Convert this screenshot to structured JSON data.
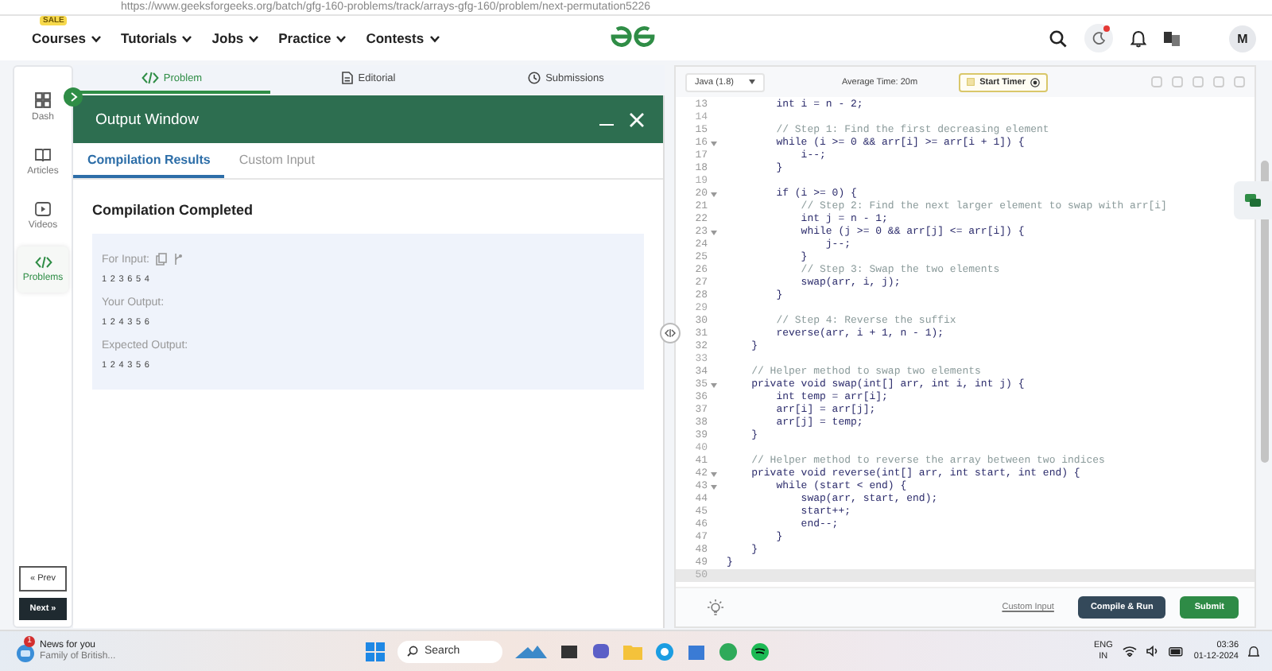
{
  "browser": {
    "url": "https://www.geeksforgeeks.org/batch/gfg-160-problems/track/arrays-gfg-160/problem/next-permutation5226"
  },
  "nav": {
    "badge": "SALE",
    "menus": [
      "Courses",
      "Tutorials",
      "Jobs",
      "Practice",
      "Contests"
    ],
    "streak_alert": true,
    "avatar": "M"
  },
  "sidebar": {
    "items": [
      {
        "label": "Dash",
        "selected": false
      },
      {
        "label": "Articles",
        "selected": false
      },
      {
        "label": "Videos",
        "selected": false
      },
      {
        "label": "Problems",
        "selected": true
      }
    ],
    "prev": "« Prev",
    "next": "Next »"
  },
  "problem_tabs": [
    {
      "label": "Problem",
      "selected": true
    },
    {
      "label": "Editorial",
      "selected": false
    },
    {
      "label": "Submissions",
      "selected": false
    }
  ],
  "output_window": {
    "title": "Output Window",
    "tabs": [
      {
        "label": "Compilation Results",
        "selected": true
      },
      {
        "label": "Custom Input",
        "selected": false
      }
    ],
    "status": "Compilation Completed",
    "results": [
      {
        "label": "For Input:",
        "value": "1 2 3 6 5 4",
        "tools": true
      },
      {
        "label": "Your Output:",
        "value": "1 2 4 3 5 6",
        "tools": false
      },
      {
        "label": "Expected Output:",
        "value": "1 2 4 3 5 6",
        "tools": false
      }
    ]
  },
  "editor": {
    "language": "Java (1.8)",
    "average_time": "Average Time: 20m",
    "timer": "Start Timer",
    "lines": [
      {
        "no": "13",
        "text": "        int i = n - 2;",
        "kind": "code",
        "fold": false,
        "current": false
      },
      {
        "no": "14",
        "kind": "code",
        "fold": false,
        "current": false
      },
      {
        "no": "15",
        "text": "        // Step 1: Find the first decreasing element",
        "kind": "comment",
        "fold": false,
        "current": false
      },
      {
        "no": "16",
        "text": "        while (i >= 0 && arr[i] >= arr[i + 1]) {",
        "kind": "code",
        "fold": true,
        "current": false
      },
      {
        "no": "17",
        "text": "            i--;",
        "kind": "code",
        "fold": false,
        "current": false
      },
      {
        "no": "18",
        "text": "        }",
        "kind": "code",
        "fold": false,
        "current": false
      },
      {
        "no": "19",
        "kind": "code",
        "fold": false,
        "current": false
      },
      {
        "no": "20",
        "text": "        if (i >= 0) {",
        "kind": "code",
        "fold": true,
        "current": false
      },
      {
        "no": "21",
        "text": "            // Step 2: Find the next larger element to swap with arr[i]",
        "kind": "comment",
        "fold": false,
        "current": false
      },
      {
        "no": "22",
        "text": "            int j = n - 1;",
        "kind": "code",
        "fold": false,
        "current": false
      },
      {
        "no": "23",
        "text": "            while (j >= 0 && arr[j] <= arr[i]) {",
        "kind": "code",
        "fold": true,
        "current": false
      },
      {
        "no": "24",
        "text": "                j--;",
        "kind": "code",
        "fold": false,
        "current": false
      },
      {
        "no": "25",
        "text": "            }",
        "kind": "code",
        "fold": false,
        "current": false
      },
      {
        "no": "26",
        "text": "            // Step 3: Swap the two elements",
        "kind": "comment",
        "fold": false,
        "current": false
      },
      {
        "no": "27",
        "text": "            swap(arr, i, j);",
        "kind": "code",
        "fold": false,
        "current": false
      },
      {
        "no": "28",
        "text": "        }",
        "kind": "code",
        "fold": false,
        "current": false
      },
      {
        "no": "29",
        "kind": "code",
        "fold": false,
        "current": false
      },
      {
        "no": "30",
        "text": "        // Step 4: Reverse the suffix",
        "kind": "comment",
        "fold": false,
        "current": false
      },
      {
        "no": "31",
        "text": "        reverse(arr, i + 1, n - 1);",
        "kind": "code",
        "fold": false,
        "current": false
      },
      {
        "no": "32",
        "text": "    }",
        "kind": "code",
        "fold": false,
        "current": false
      },
      {
        "no": "33",
        "kind": "code",
        "fold": false,
        "current": false
      },
      {
        "no": "34",
        "text": "    // Helper method to swap two elements",
        "kind": "comment",
        "fold": false,
        "current": false
      },
      {
        "no": "35",
        "text": "    private void swap(int[] arr, int i, int j) {",
        "kind": "code",
        "fold": true,
        "current": false
      },
      {
        "no": "36",
        "text": "        int temp = arr[i];",
        "kind": "code",
        "fold": false,
        "current": false
      },
      {
        "no": "37",
        "text": "        arr[i] = arr[j];",
        "kind": "code",
        "fold": false,
        "current": false
      },
      {
        "no": "38",
        "text": "        arr[j] = temp;",
        "kind": "code",
        "fold": false,
        "current": false
      },
      {
        "no": "39",
        "text": "    }",
        "kind": "code",
        "fold": false,
        "current": false
      },
      {
        "no": "40",
        "kind": "code",
        "fold": false,
        "current": false
      },
      {
        "no": "41",
        "text": "    // Helper method to reverse the array between two indices",
        "kind": "comment",
        "fold": false,
        "current": false
      },
      {
        "no": "42",
        "text": "    private void reverse(int[] arr, int start, int end) {",
        "kind": "code",
        "fold": true,
        "current": false
      },
      {
        "no": "43",
        "text": "        while (start < end) {",
        "kind": "code",
        "fold": true,
        "current": false
      },
      {
        "no": "44",
        "text": "            swap(arr, start, end);",
        "kind": "code",
        "fold": false,
        "current": false
      },
      {
        "no": "45",
        "text": "            start++;",
        "kind": "code",
        "fold": false,
        "current": false
      },
      {
        "no": "46",
        "text": "            end--;",
        "kind": "code",
        "fold": false,
        "current": false
      },
      {
        "no": "47",
        "text": "        }",
        "kind": "code",
        "fold": false,
        "current": false
      },
      {
        "no": "48",
        "text": "    }",
        "kind": "code",
        "fold": false,
        "current": false
      },
      {
        "no": "49",
        "text": "}",
        "kind": "code",
        "fold": false,
        "current": false
      },
      {
        "no": "50",
        "kind": "code",
        "fold": false,
        "current": true
      }
    ],
    "custom_input": "Custom Input",
    "compile": "Compile & Run",
    "submit": "Submit"
  },
  "taskbar": {
    "news_count": "1",
    "news_title": "News for you",
    "news_text": "Family of British...",
    "search": "Search",
    "lang": "ENG",
    "region": "IN",
    "time": "03:36",
    "date": "01-12-2024"
  }
}
